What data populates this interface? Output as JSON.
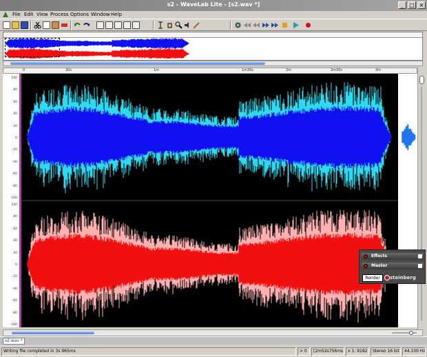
{
  "window": {
    "title": "s2 - WaveLab Lite - [s2.wav *]",
    "controls": [
      "_",
      "□",
      "×"
    ]
  },
  "menu": [
    "File",
    "Edit",
    "View",
    "Process",
    "Options",
    "Window",
    "Help"
  ],
  "toolbar": {
    "icons": [
      "new-icon",
      "open-icon",
      "save-icon",
      "cut-icon",
      "copy-icon",
      "paste-icon",
      "trim-icon",
      "undo-icon",
      "redo-icon",
      "select-icon",
      "zoom-icon",
      "play-icon",
      "stop-icon",
      "record-icon"
    ]
  },
  "ruler": {
    "labels": [
      "0",
      "30s",
      "1m",
      "1m30s",
      "2m",
      "2m30s",
      "3m"
    ]
  },
  "amplitude_scale": {
    "labels": [
      "100",
      "80",
      "60",
      "40",
      "20",
      "0",
      "-20",
      "-40",
      "-60",
      "-80",
      "-100"
    ]
  },
  "tabs": {
    "file_tab": "s2.wav *"
  },
  "status": {
    "message": "Writing file completed in 3s 965ms",
    "cursor": "> 0",
    "selection": "[2m52s756ms]",
    "zoom": "x 1: 9182",
    "format": "Stereo 16 bit",
    "rate": "44.100 Hz"
  },
  "fx_panel": {
    "effects": "Effects",
    "master": "Master",
    "render": "Render",
    "brand": "steinberg"
  },
  "colors": {
    "left_channel": "#1010f0",
    "left_edge": "#30d8f0",
    "right_channel": "#f01010",
    "right_edge": "#ffb0b0",
    "wave_bg": "#000000"
  }
}
